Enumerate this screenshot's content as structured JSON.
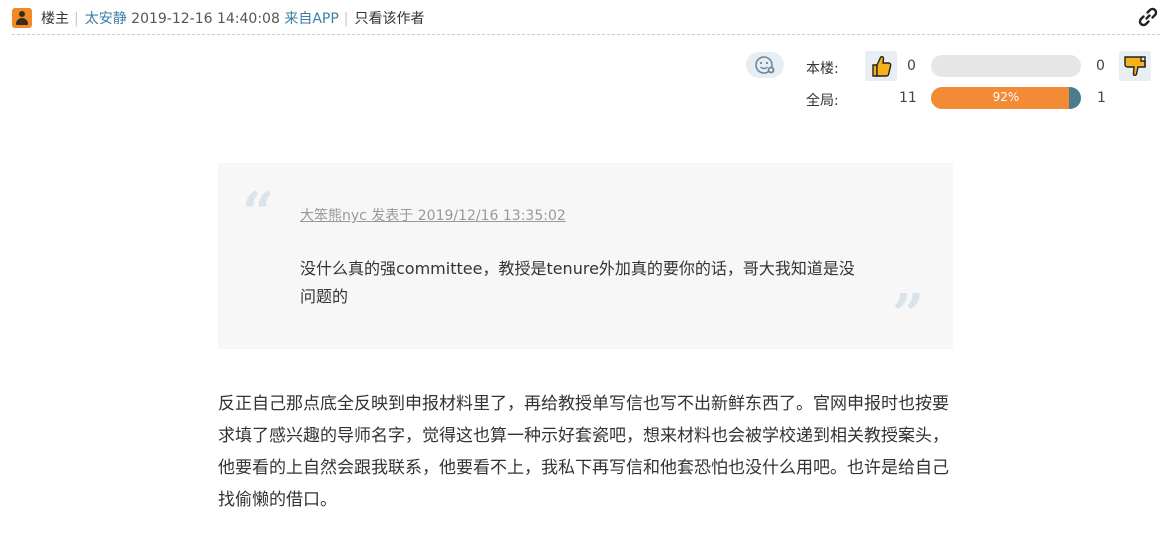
{
  "header": {
    "role_label": "楼主",
    "separator": "|",
    "author": "太安静",
    "datetime": "2019-12-16 14:40:08",
    "source": "来自APP",
    "only_author": "只看该作者"
  },
  "vote": {
    "this_floor_label": "本楼:",
    "overall_label": "全局:",
    "floor_up": "0",
    "floor_down": "0",
    "floor_ratio": 0,
    "overall_up": "11",
    "overall_down": "1",
    "overall_percent_text": "92%",
    "overall_ratio": 0.92
  },
  "quote": {
    "meta": "大笨熊nyc 发表于 2019/12/16 13:35:02",
    "open_mark": "“",
    "close_mark": "”",
    "text": "没什么真的强committee，教授是tenure外加真的要你的话，哥大我知道是没问题的"
  },
  "post": {
    "body": "反正自己那点底全反映到申报材料里了，再给教授单写信也写不出新鲜东西了。官网申报时也按要求填了感兴趣的导师名字，觉得这也算一种示好套瓷吧，想来材料也会被学校递到相关教授案头，他要看的上自然会跟我联系，他要看不上，我私下再写信和他套恐怕也没什么用吧。也许是给自己找偷懒的借口。"
  },
  "colors": {
    "accent_link": "#3b7fa6",
    "bar_fill": "#f28a36",
    "bar_rest": "#4c7b8e",
    "quote_bg": "#f7f7f7"
  },
  "icons": {
    "avatar": "avatar-icon",
    "link": "link-icon",
    "emoji": "emoji-icon",
    "thumb_up": "thumbs-up-icon",
    "thumb_down": "thumbs-down-icon"
  }
}
